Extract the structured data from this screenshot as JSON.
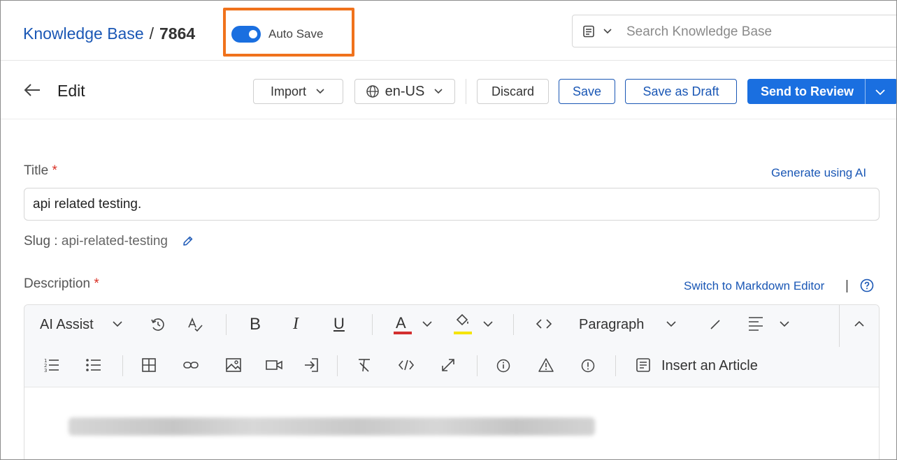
{
  "header": {
    "breadcrumb_root": "Knowledge Base",
    "breadcrumb_sep": "/",
    "breadcrumb_id": "7864",
    "autosave_label": "Auto Save",
    "autosave_on": true,
    "search_placeholder": "Search Knowledge Base"
  },
  "toolbar": {
    "page_title": "Edit",
    "import_label": "Import",
    "locale_label": "en-US",
    "discard_label": "Discard",
    "save_label": "Save",
    "save_draft_label": "Save as Draft",
    "send_review_label": "Send to Review"
  },
  "form": {
    "title_label": "Title",
    "required_mark": "*",
    "generate_ai_label": "Generate using AI",
    "title_value": "api related testing.",
    "slug_label": "Slug :",
    "slug_value": "api-related-testing",
    "description_label": "Description",
    "markdown_switch_label": "Switch to Markdown Editor",
    "pipe": "|"
  },
  "editor": {
    "ai_assist_label": "AI Assist",
    "bold": "B",
    "italic": "I",
    "underline": "U",
    "font_color_letter": "A",
    "paragraph_label": "Paragraph",
    "insert_article_label": "Insert an Article"
  },
  "colors": {
    "primary": "#1a6fe0",
    "link": "#1a57b5",
    "highlight_box": "#f0721c",
    "required": "#d93025",
    "font_color_bar": "#d32f2f",
    "highlight_color_bar": "#f5e400"
  }
}
